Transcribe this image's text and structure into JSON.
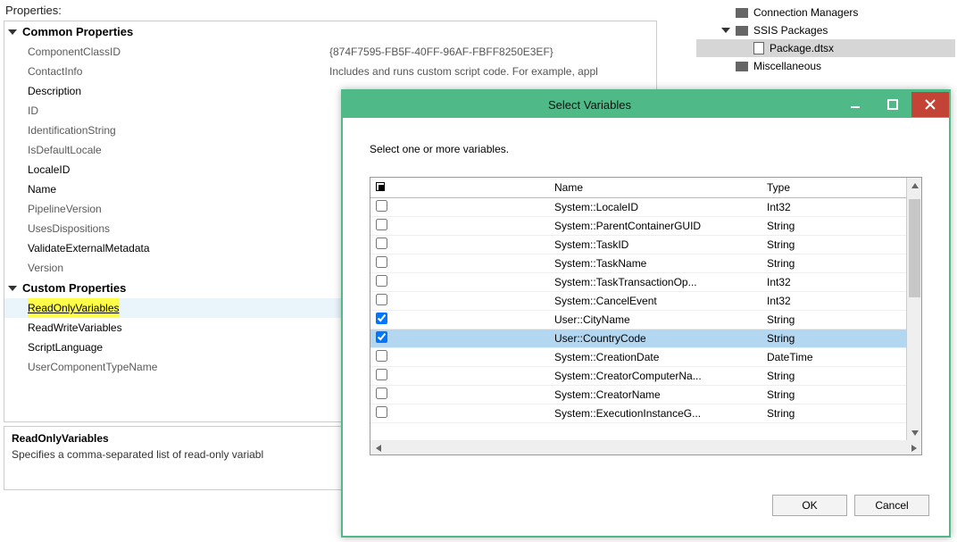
{
  "propsPanel": {
    "title": "Properties:",
    "groups": {
      "common": {
        "label": "Common Properties",
        "items": [
          {
            "name": "ComponentClassID",
            "value": "{874F7595-FB5F-40FF-96AF-FBFF8250E3EF}",
            "shade": "light"
          },
          {
            "name": "ContactInfo",
            "value": "Includes and runs custom script code. For example, appl",
            "shade": "light"
          },
          {
            "name": "Description",
            "value": "",
            "shade": "dark"
          },
          {
            "name": "ID",
            "value": "",
            "shade": "light"
          },
          {
            "name": "IdentificationString",
            "value": "",
            "shade": "light"
          },
          {
            "name": "IsDefaultLocale",
            "value": "",
            "shade": "light"
          },
          {
            "name": "LocaleID",
            "value": "",
            "shade": "dark"
          },
          {
            "name": "Name",
            "value": "",
            "shade": "dark"
          },
          {
            "name": "PipelineVersion",
            "value": "",
            "shade": "light"
          },
          {
            "name": "UsesDispositions",
            "value": "",
            "shade": "light"
          },
          {
            "name": "ValidateExternalMetadata",
            "value": "",
            "shade": "dark"
          },
          {
            "name": "Version",
            "value": "",
            "shade": "light"
          }
        ]
      },
      "custom": {
        "label": "Custom Properties",
        "items": [
          {
            "name": "ReadOnlyVariables",
            "highlight": true,
            "selected": true,
            "shade": "dark"
          },
          {
            "name": "ReadWriteVariables",
            "shade": "dark"
          },
          {
            "name": "ScriptLanguage",
            "shade": "dark"
          },
          {
            "name": "UserComponentTypeName",
            "shade": "light"
          }
        ]
      }
    },
    "desc": {
      "title": "ReadOnlyVariables",
      "body": "Specifies a comma-separated list of read-only variabl"
    }
  },
  "solutionTree": {
    "items": [
      {
        "label": "Connection Managers",
        "icon": "folder"
      },
      {
        "label": "SSIS Packages",
        "icon": "folder",
        "expanded": true
      },
      {
        "label": "Package.dtsx",
        "icon": "file",
        "indent": true,
        "selected": true
      },
      {
        "label": "Miscellaneous",
        "icon": "folder"
      }
    ]
  },
  "dialog": {
    "title": "Select Variables",
    "instruction": "Select one or more variables.",
    "columns": {
      "name": "Name",
      "type": "Type"
    },
    "buttons": {
      "ok": "OK",
      "cancel": "Cancel"
    },
    "rows": [
      {
        "checked": false,
        "name": "System::LocaleID",
        "type": "Int32"
      },
      {
        "checked": false,
        "name": "System::ParentContainerGUID",
        "type": "String"
      },
      {
        "checked": false,
        "name": "System::TaskID",
        "type": "String"
      },
      {
        "checked": false,
        "name": "System::TaskName",
        "type": "String"
      },
      {
        "checked": false,
        "name": "System::TaskTransactionOp...",
        "type": "Int32"
      },
      {
        "checked": false,
        "name": "System::CancelEvent",
        "type": "Int32"
      },
      {
        "checked": true,
        "name": "User::CityName",
        "type": "String"
      },
      {
        "checked": true,
        "name": "User::CountryCode",
        "type": "String",
        "selected": true
      },
      {
        "checked": false,
        "name": "System::CreationDate",
        "type": "DateTime"
      },
      {
        "checked": false,
        "name": "System::CreatorComputerNa...",
        "type": "String"
      },
      {
        "checked": false,
        "name": "System::CreatorName",
        "type": "String"
      },
      {
        "checked": false,
        "name": "System::ExecutionInstanceG...",
        "type": "String"
      }
    ]
  }
}
